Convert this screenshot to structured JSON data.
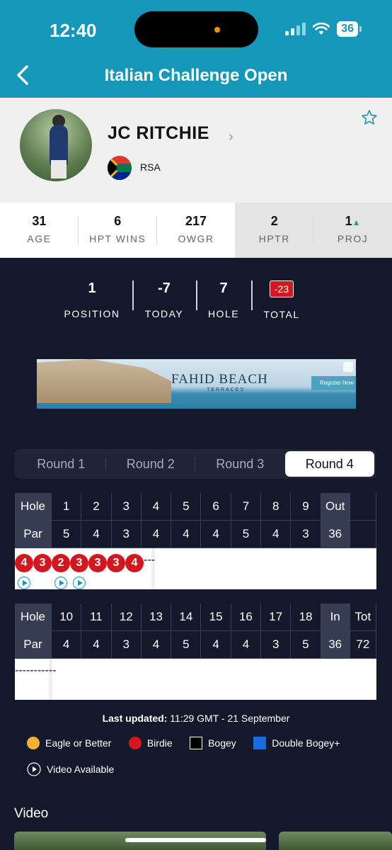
{
  "status": {
    "time": "12:40",
    "battery": "36"
  },
  "nav": {
    "title": "Italian Challenge Open"
  },
  "player": {
    "name": "JC RITCHIE",
    "country": "RSA"
  },
  "stats": [
    {
      "value": "31",
      "label": "AGE"
    },
    {
      "value": "6",
      "label": "HPT WINS"
    },
    {
      "value": "217",
      "label": "OWGR"
    },
    {
      "value": "2",
      "label": "HPTR"
    },
    {
      "value": "1",
      "label": "PROJ",
      "trend": "▲"
    }
  ],
  "summary": {
    "position": {
      "value": "1",
      "label": "POSITION"
    },
    "today": {
      "value": "-7",
      "label": "TODAY"
    },
    "hole": {
      "value": "7",
      "label": "HOLE"
    },
    "total": {
      "value": "-23",
      "label": "TOTAL"
    }
  },
  "ad": {
    "brand": "FAHID BEACH",
    "sub": "TERRACES",
    "cta": "Register Now"
  },
  "rounds": [
    "Round 1",
    "Round 2",
    "Round 3",
    "Round 4"
  ],
  "active_round": "Round 4",
  "front": {
    "hole_label": "Hole",
    "par_label": "Par",
    "holes": [
      "1",
      "2",
      "3",
      "4",
      "5",
      "6",
      "7",
      "8",
      "9"
    ],
    "pars": [
      "5",
      "4",
      "3",
      "4",
      "4",
      "4",
      "5",
      "4",
      "3"
    ],
    "scores": [
      "4",
      "3",
      "2",
      "3",
      "3",
      "3",
      "4",
      "-",
      "-"
    ],
    "video": [
      true,
      false,
      true,
      true,
      false,
      false,
      false,
      false,
      false
    ],
    "sum_label": "Out",
    "sum_par": "36",
    "sum_score": "-"
  },
  "back": {
    "hole_label": "Hole",
    "par_label": "Par",
    "holes": [
      "10",
      "11",
      "12",
      "13",
      "14",
      "15",
      "16",
      "17",
      "18"
    ],
    "pars": [
      "4",
      "4",
      "3",
      "4",
      "5",
      "4",
      "4",
      "3",
      "5"
    ],
    "scores": [
      "-",
      "-",
      "-",
      "-",
      "-",
      "-",
      "-",
      "-",
      "-"
    ],
    "sum_label": "In",
    "sum_par": "36",
    "sum_score": "-",
    "tot_label": "Tot",
    "tot_par": "72",
    "tot_score": "-"
  },
  "updated": {
    "label": "Last updated:",
    "value": "11:29 GMT - 21 September"
  },
  "legend": [
    {
      "label": "Eagle or Better",
      "color": "#f2b233",
      "shape": "circle"
    },
    {
      "label": "Birdie",
      "color": "#d4161f",
      "shape": "circle"
    },
    {
      "label": "Bogey",
      "color": "#000000",
      "shape": "square"
    },
    {
      "label": "Double Bogey+",
      "color": "#1b6be0",
      "shape": "square"
    },
    {
      "label": "Video Available",
      "color": "",
      "shape": "play"
    }
  ],
  "video_section": {
    "title": "Video"
  },
  "colors": {
    "brand": "#1497b8",
    "birdie": "#d4161f",
    "bg": "#13192b"
  }
}
